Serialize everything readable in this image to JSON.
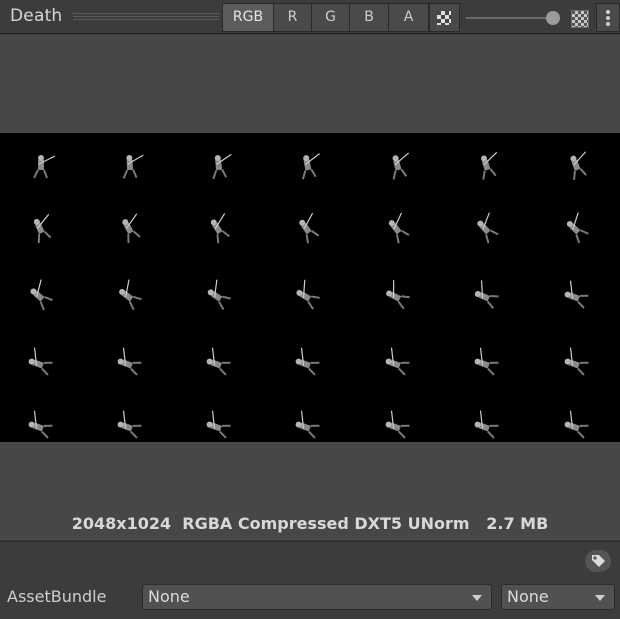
{
  "toolbar": {
    "title": "Death",
    "channels": [
      {
        "label": "RGB",
        "active": true
      },
      {
        "label": "R",
        "active": false
      },
      {
        "label": "G",
        "active": false
      },
      {
        "label": "B",
        "active": false
      },
      {
        "label": "A",
        "active": false
      }
    ],
    "alpha_toggle_icon": "checkerboard-icon",
    "mip_slider_icon": "slider-icon",
    "background_toggle_icon": "checkerboard-icon",
    "menu_icon": "kebab-menu-icon"
  },
  "preview": {
    "info_text": "2048x1024  RGBA Compressed DXT5 UNorm   2.7 MB",
    "sprite_rows": 5,
    "sprite_cols": 7,
    "background_color": "#000000"
  },
  "asset_bundle": {
    "label": "AssetBundle",
    "name_value": "None",
    "variant_value": "None",
    "tag_icon": "tag-icon"
  }
}
